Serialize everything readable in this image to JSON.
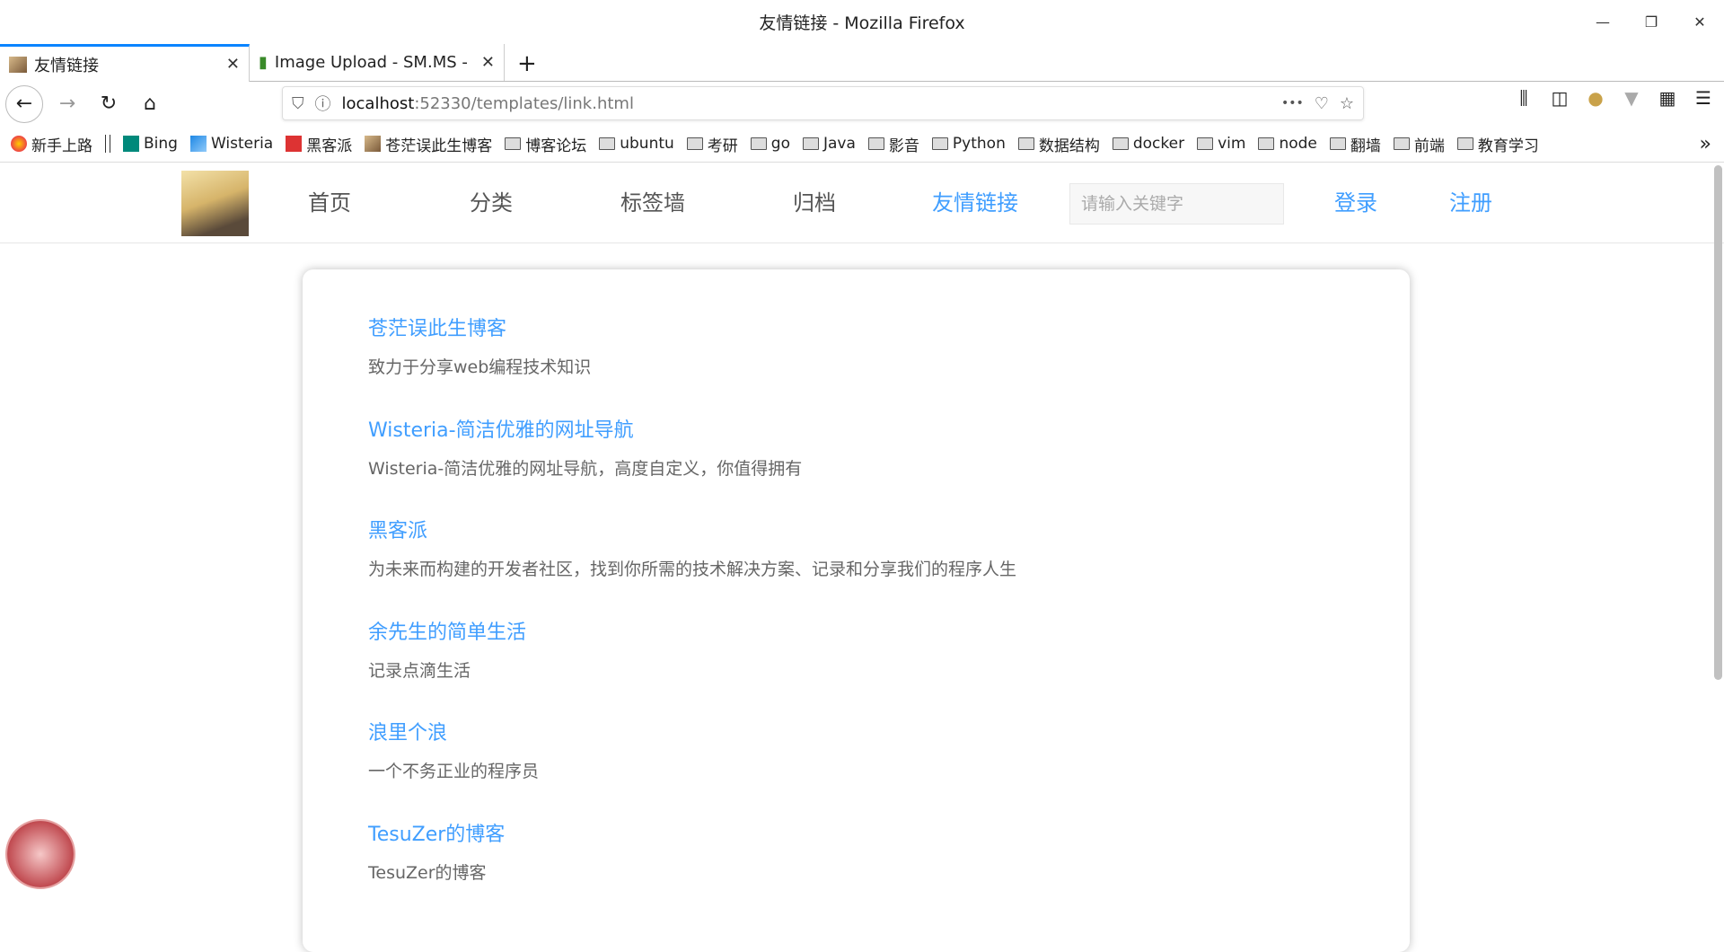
{
  "window": {
    "title": "友情链接 - Mozilla Firefox",
    "minimize": "—",
    "restore": "❐",
    "close": "✕"
  },
  "tabs": [
    {
      "label": "友情链接",
      "close": "✕"
    },
    {
      "label": "Image Upload - SM.MS - ",
      "close": "✕"
    }
  ],
  "new_tab": "+",
  "toolbar": {
    "url_host": "localhost",
    "url_rest": ":52330/templates/link.html",
    "more": "•••"
  },
  "bookmarks": [
    {
      "label": "新手上路",
      "icon": "firefox"
    },
    {
      "label": "Bing",
      "icon": "bing"
    },
    {
      "label": "Wisteria",
      "icon": "arrow"
    },
    {
      "label": "黑客派",
      "icon": "hacpai"
    },
    {
      "label": "苍茫误此生博客",
      "icon": "image"
    },
    {
      "label": "博客论坛",
      "icon": "folder"
    },
    {
      "label": "ubuntu",
      "icon": "folder"
    },
    {
      "label": "考研",
      "icon": "folder"
    },
    {
      "label": "go",
      "icon": "folder"
    },
    {
      "label": "Java",
      "icon": "folder"
    },
    {
      "label": "影音",
      "icon": "folder"
    },
    {
      "label": "Python",
      "icon": "folder"
    },
    {
      "label": "数据结构",
      "icon": "folder"
    },
    {
      "label": "docker",
      "icon": "folder"
    },
    {
      "label": "vim",
      "icon": "folder"
    },
    {
      "label": "node",
      "icon": "folder"
    },
    {
      "label": "翻墙",
      "icon": "folder"
    },
    {
      "label": "前端",
      "icon": "folder"
    },
    {
      "label": "教育学习",
      "icon": "folder"
    }
  ],
  "site": {
    "nav": [
      {
        "label": "首页"
      },
      {
        "label": "分类"
      },
      {
        "label": "标签墙"
      },
      {
        "label": "归档"
      },
      {
        "label": "友情链接"
      }
    ],
    "search_placeholder": "请输入关键字",
    "login": "登录",
    "register": "注册",
    "accent": "#409eff"
  },
  "links": [
    {
      "title": "苍茫误此生博客",
      "desc": "致力于分享web编程技术知识"
    },
    {
      "title": "Wisteria-简洁优雅的网址导航",
      "desc": "Wisteria-简洁优雅的网址导航，高度自定义，你值得拥有"
    },
    {
      "title": "黑客派",
      "desc": "为未来而构建的开发者社区，找到你所需的技术解决方案、记录和分享我们的程序人生"
    },
    {
      "title": "余先生的简单生活",
      "desc": "记录点滴生活"
    },
    {
      "title": "浪里个浪",
      "desc": "一个不务正业的程序员"
    },
    {
      "title": "TesuZer的博客",
      "desc": "TesuZer的博客"
    }
  ]
}
